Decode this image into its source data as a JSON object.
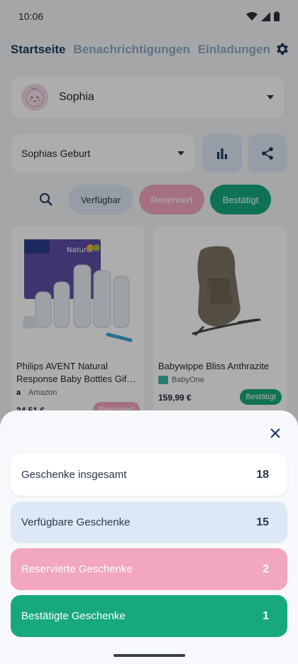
{
  "status_bar": {
    "time": "10:06"
  },
  "nav": {
    "tabs": [
      {
        "label": "Startseite",
        "active": true
      },
      {
        "label": "Benachrichtigungen",
        "active": false
      },
      {
        "label": "Einladungen",
        "active": false
      }
    ],
    "settings_icon": "gear-icon"
  },
  "profile": {
    "name": "Sophia",
    "avatar_icon": "baby-face-avatar"
  },
  "event": {
    "name": "Sophias Geburt"
  },
  "actions": {
    "stats_icon": "bar-chart-icon",
    "share_icon": "share-icon"
  },
  "filters": {
    "search_icon": "search-icon",
    "available": "Verfügbar",
    "reserved": "Reserviert",
    "confirmed": "Bestätigt"
  },
  "gifts": [
    {
      "title": "Philips AVENT Natural Response Baby Bottles Gif…",
      "shop": "Amazon",
      "price": "34,51 €",
      "status": "Reserviert",
      "status_color": "#f2a6c0"
    },
    {
      "title": "Babywippe Bliss Anthrazite",
      "shop": "BabyOne",
      "price": "159,99 €",
      "status": "Bestätigt",
      "status_color": "#17a97c"
    }
  ],
  "sheet": {
    "stats": {
      "total": {
        "label": "Geschenke insgesamt",
        "count": "18"
      },
      "available": {
        "label": "Verfügbare Geschenke",
        "count": "15"
      },
      "reserved": {
        "label": "Reservierte Geschenke",
        "count": "2"
      },
      "confirmed": {
        "label": "Bestätigte Geschenke",
        "count": "1"
      }
    }
  },
  "colors": {
    "primary_dark": "#1b3a5e",
    "available": "#dde8f6",
    "reserved": "#f2a6c0",
    "confirmed": "#17a97c"
  }
}
